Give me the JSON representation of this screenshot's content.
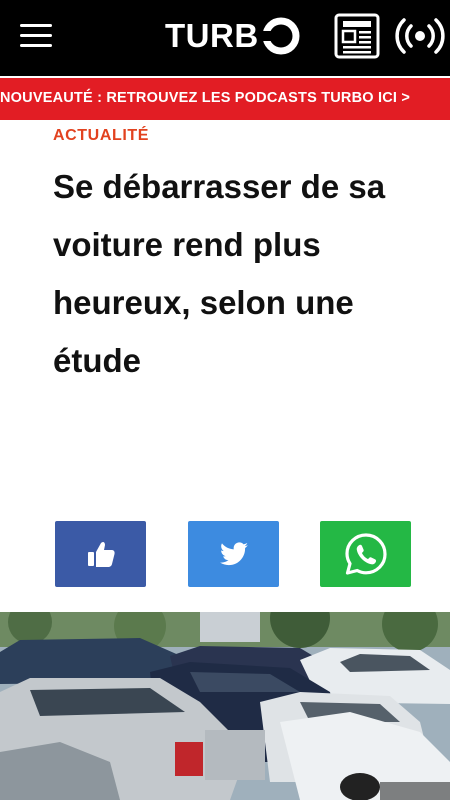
{
  "header": {
    "logo_text": "TURBO",
    "menu_icon": "hamburger-menu-icon",
    "newspaper_icon": "newspaper-icon",
    "live_icon": "broadcast-icon",
    "background_color": "#000000"
  },
  "ticker": {
    "text": "NOUVEAUTÉ : RETROUVEZ LES PODCASTS TURBO ICI >",
    "background_color": "#e21d24"
  },
  "article": {
    "category": "ACTUALITÉ",
    "title": "Se débarrasser de sa voiture rend plus heureux, selon une étude",
    "category_color": "#e2421f"
  },
  "share": {
    "buttons": [
      {
        "icon": "thumbs-up-icon",
        "color": "#3b5aa6"
      },
      {
        "icon": "twitter-bird-icon",
        "color": "#3d8be0"
      },
      {
        "icon": "whatsapp-icon",
        "color": "#24b845"
      }
    ]
  },
  "image": {
    "subject": "parked cars"
  }
}
